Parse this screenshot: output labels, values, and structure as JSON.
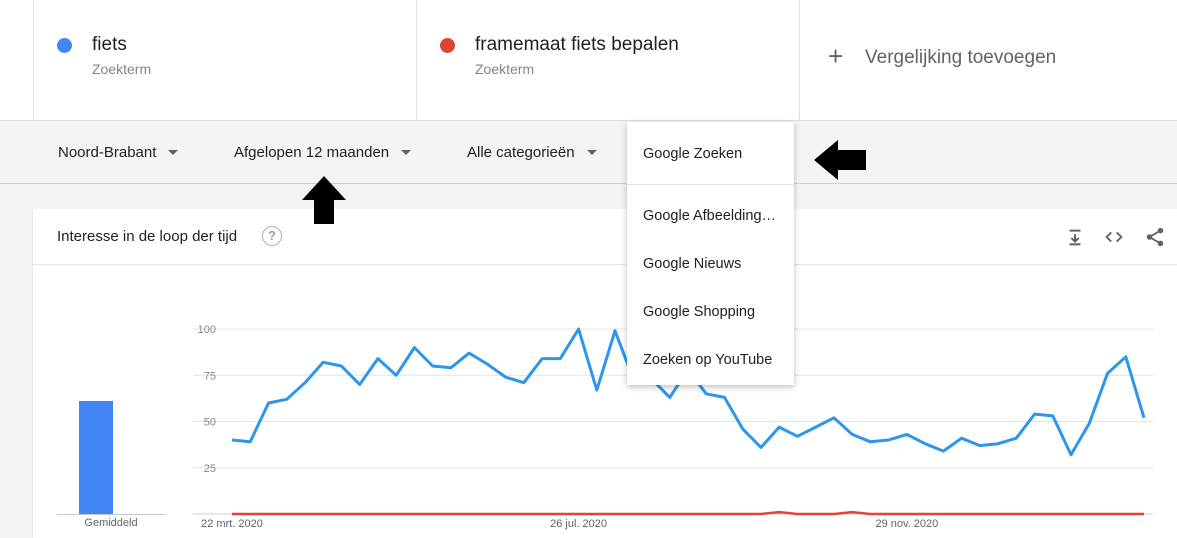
{
  "terms": [
    {
      "name": "fiets",
      "type": "Zoekterm",
      "color": "#4285f4"
    },
    {
      "name": "framemaat fiets bepalen",
      "type": "Zoekterm",
      "color": "#db4437"
    }
  ],
  "add_comparison": {
    "icon": "plus-icon",
    "label": "Vergelijking toevoegen"
  },
  "filters": {
    "region": "Noord-Brabant",
    "period": "Afgelopen 12 maanden",
    "category": "Alle categorieën"
  },
  "dropdown": {
    "items": [
      "Google Zoeken",
      "Google Afbeelding…",
      "Google Nieuws",
      "Google Shopping",
      "Zoeken op YouTube"
    ],
    "selected": "Google Zoeken"
  },
  "card": {
    "title": "Interesse in de loop der tijd",
    "help_icon": "question-circle-icon",
    "actions": [
      "download-icon",
      "embed-code-icon",
      "share-icon"
    ],
    "average_label": "Gemiddeld"
  },
  "chart_data": {
    "type": "line",
    "ylim": [
      0,
      100
    ],
    "yticks": [
      25,
      50,
      75,
      100
    ],
    "xtick_labels": [
      "22 mrt. 2020",
      "26 jul. 2020",
      "29 nov. 2020"
    ],
    "averages": {
      "fiets": 61,
      "framemaat fiets bepalen": 0
    },
    "series": [
      {
        "name": "fiets",
        "color": "#2d96ec",
        "values": [
          40,
          39,
          60,
          62,
          71,
          82,
          80,
          70,
          84,
          75,
          90,
          80,
          79,
          87,
          81,
          74,
          71,
          84,
          84,
          100,
          67,
          99,
          73,
          73,
          63,
          78,
          65,
          63,
          46,
          36,
          47,
          42,
          47,
          52,
          43,
          39,
          40,
          43,
          38,
          34,
          41,
          37,
          38,
          41,
          54,
          53,
          32,
          49,
          76,
          85,
          52
        ]
      },
      {
        "name": "framemaat fiets bepalen",
        "color": "#e2443b",
        "values": [
          0,
          0,
          0,
          0,
          0,
          0,
          0,
          0,
          0,
          0,
          0,
          0,
          0,
          0,
          0,
          0,
          0,
          0,
          0,
          0,
          0,
          0,
          0,
          0,
          0,
          0,
          0,
          0,
          0,
          0,
          1,
          0,
          0,
          0,
          1,
          0,
          0,
          0,
          0,
          0,
          0,
          0,
          0,
          0,
          0,
          0,
          0,
          0,
          0,
          0,
          0
        ]
      }
    ]
  }
}
